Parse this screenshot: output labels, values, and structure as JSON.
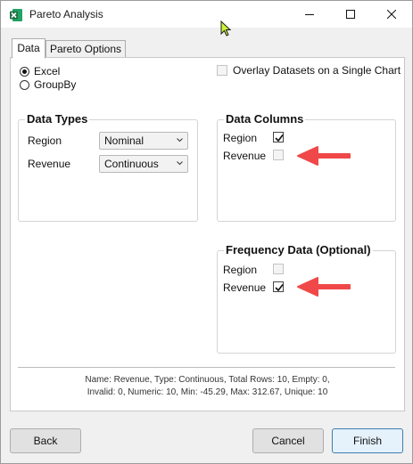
{
  "window": {
    "title": "Pareto Analysis",
    "app_icon": "excel-icon"
  },
  "tabs": [
    {
      "label": "Data",
      "selected": true
    },
    {
      "label": "Pareto Options",
      "selected": false
    }
  ],
  "source": {
    "options": [
      {
        "label": "Excel",
        "selected": true
      },
      {
        "label": "GroupBy",
        "selected": false
      }
    ]
  },
  "overlay": {
    "label": "Overlay Datasets on a Single Chart",
    "checked": false,
    "enabled": false
  },
  "data_types": {
    "title": "Data Types",
    "rows": [
      {
        "label": "Region",
        "value": "Nominal"
      },
      {
        "label": "Revenue",
        "value": "Continuous"
      }
    ]
  },
  "data_columns": {
    "title": "Data Columns",
    "rows": [
      {
        "label": "Region",
        "checked": true,
        "enabled": true
      },
      {
        "label": "Revenue",
        "checked": false,
        "enabled": false
      }
    ]
  },
  "frequency_data": {
    "title": "Frequency Data (Optional)",
    "rows": [
      {
        "label": "Region",
        "checked": false,
        "enabled": false
      },
      {
        "label": "Revenue",
        "checked": true,
        "enabled": true
      }
    ]
  },
  "status": {
    "line1": "Name: Revenue, Type: Continuous, Total Rows: 10, Empty: 0,",
    "line2": "Invalid: 0, Numeric: 10, Min: -45.29, Max: 312.67, Unique: 10"
  },
  "buttons": {
    "back": "Back",
    "cancel": "Cancel",
    "finish": "Finish"
  },
  "colors": {
    "annotation_arrow": "#f04848",
    "excel_green": "#1e7145"
  }
}
